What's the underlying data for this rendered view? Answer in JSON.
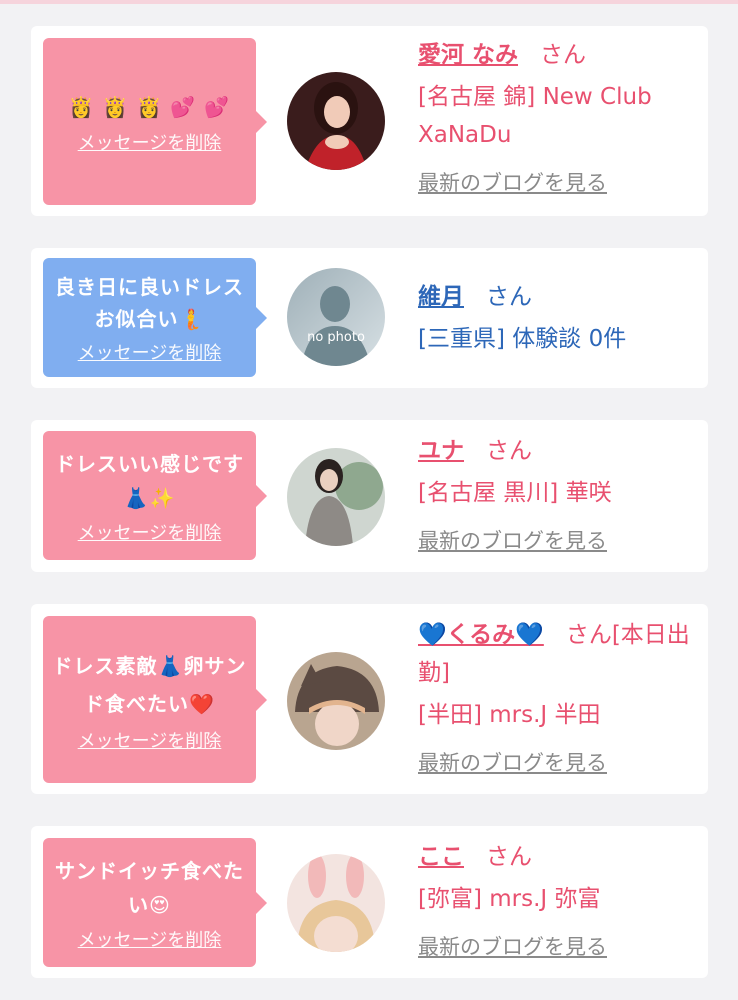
{
  "cards": [
    {
      "message": "👸 👸 👸 💕 💕",
      "delete_label": "メッセージを削除",
      "name": "愛河 なみ",
      "san": "さん",
      "shop": "[名古屋 錦] New Club XaNaDu",
      "blog_label": "最新のブログを見る",
      "avatar": "photo"
    },
    {
      "message": "良き日に良いドレスお似合い🧜",
      "delete_label": "メッセージを削除",
      "name": "維月",
      "san": "さん",
      "shop": "[三重県] 体験談 0件",
      "avatar": "no-photo",
      "avatar_text": "no photo"
    },
    {
      "message": "ドレスいい感じです👗✨",
      "delete_label": "メッセージを削除",
      "name": "ユナ",
      "san": "さん",
      "shop": "[名古屋 黒川] 華咲",
      "blog_label": "最新のブログを見る",
      "avatar": "photo"
    },
    {
      "message": "ドレス素敵👗卵サンド食べたい❤️",
      "delete_label": "メッセージを削除",
      "name": "💙くるみ💙",
      "san": "さん[本日出勤]",
      "shop": "[半田] mrs.J 半田",
      "blog_label": "最新のブログを見る",
      "avatar": "photo"
    },
    {
      "message": "サンドイッチ食べたい😍",
      "delete_label": "メッセージを削除",
      "name": "ここ",
      "san": "さん",
      "shop": "[弥富] mrs.J 弥富",
      "blog_label": "最新のブログを見る",
      "avatar": "photo"
    }
  ],
  "colors": {
    "pink_bubble": "#f794a6",
    "blue_bubble": "#80aef0",
    "pink_text": "#e8506f",
    "blue_text": "#2d67b8",
    "link_gray": "#8a8a8a",
    "page_bg": "#f2f2f4"
  }
}
